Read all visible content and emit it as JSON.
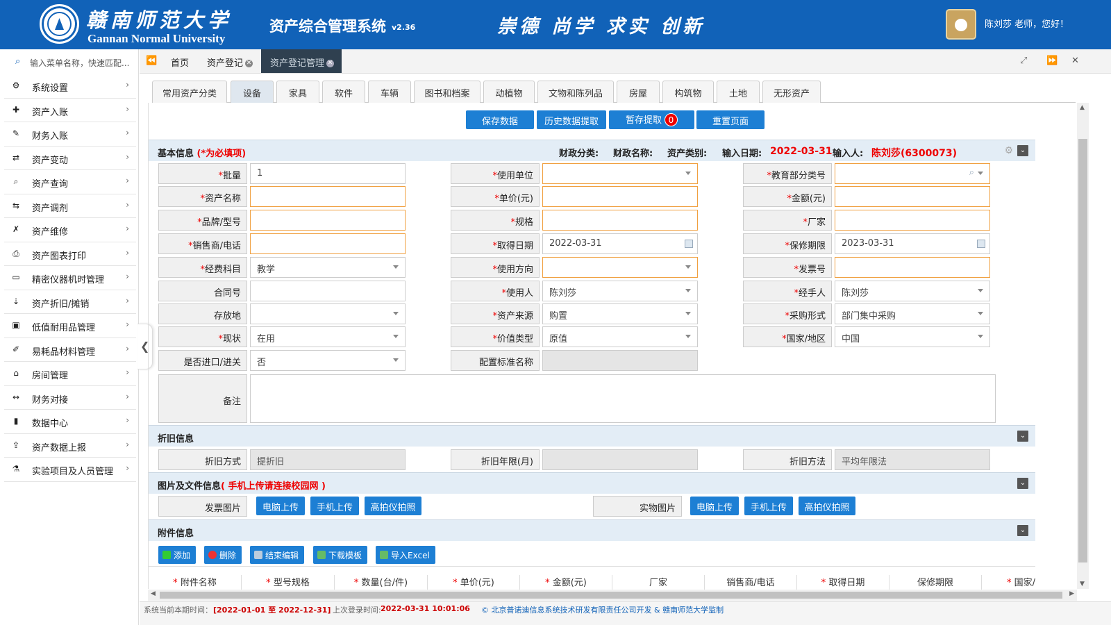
{
  "header": {
    "univ_cn": "赣南师范大学",
    "univ_en": "Gannan Normal University",
    "system_title": "资产综合管理系统",
    "version": "v2.36",
    "motto": "崇德 尚学 求实 创新",
    "greeting": "陈刘莎 老师，您好！"
  },
  "sidebar": {
    "search_placeholder": "输入菜单名称，快速匹配...",
    "items": [
      {
        "label": "系统设置",
        "icon": "gear-icon",
        "glyph": "⚙"
      },
      {
        "label": "资产入账",
        "icon": "plus-icon",
        "glyph": "✚"
      },
      {
        "label": "财务入账",
        "icon": "edit-icon",
        "glyph": "✎"
      },
      {
        "label": "资产变动",
        "icon": "shuffle-icon",
        "glyph": "⇄"
      },
      {
        "label": "资产查询",
        "icon": "search-icon",
        "glyph": "⌕"
      },
      {
        "label": "资产调剂",
        "icon": "exchange-icon",
        "glyph": "⇆"
      },
      {
        "label": "资产维修",
        "icon": "wrench-icon",
        "glyph": "✗"
      },
      {
        "label": "资产图表打印",
        "icon": "print-icon",
        "glyph": "⎙"
      },
      {
        "label": "精密仪器机时管理",
        "icon": "monitor-icon",
        "glyph": "▭"
      },
      {
        "label": "资产折旧/摊销",
        "icon": "sort-icon",
        "glyph": "⇣"
      },
      {
        "label": "低值耐用品管理",
        "icon": "money-icon",
        "glyph": "▣"
      },
      {
        "label": "易耗品材料管理",
        "icon": "tools-icon",
        "glyph": "✐"
      },
      {
        "label": "房间管理",
        "icon": "home-icon",
        "glyph": "⌂"
      },
      {
        "label": "财务对接",
        "icon": "link-icon",
        "glyph": "↔"
      },
      {
        "label": "数据中心",
        "icon": "book-icon",
        "glyph": "▮"
      },
      {
        "label": "资产数据上报",
        "icon": "upload-icon",
        "glyph": "⇪"
      },
      {
        "label": "实验项目及人员管理",
        "icon": "flask-icon",
        "glyph": "⚗"
      }
    ]
  },
  "page_tabs": [
    "首页",
    "资产登记",
    "资产登记管理"
  ],
  "asset_tabs": [
    "常用资产分类",
    "设备",
    "家具",
    "软件",
    "车辆",
    "图书和档案",
    "动植物",
    "文物和陈列品",
    "房屋",
    "构筑物",
    "土地",
    "无形资产"
  ],
  "actions": {
    "save": "保存数据",
    "history": "历史数据提取",
    "temp": "暂存提取",
    "temp_count": "0",
    "reset": "重置页面"
  },
  "basic": {
    "title": "基本信息",
    "required_note": "(*为必填项)",
    "fin_category_label": "财政分类:",
    "fin_name_label": "财政名称:",
    "asset_type_label": "资产类别:",
    "entry_date_label": "输入日期:",
    "entry_date": "2022-03-31",
    "entry_user_label": "输入人:",
    "entry_user": "陈刘莎(6300073)",
    "fields": {
      "batch": {
        "label": "批量",
        "value": "1"
      },
      "use_unit": {
        "label": "使用单位",
        "value": ""
      },
      "edu_code": {
        "label": "教育部分类号",
        "value": ""
      },
      "asset_name": {
        "label": "资产名称",
        "value": ""
      },
      "unit_price": {
        "label": "单价(元)",
        "value": ""
      },
      "amount": {
        "label": "金额(元)",
        "value": ""
      },
      "brand": {
        "label": "品牌/型号",
        "value": ""
      },
      "spec": {
        "label": "规格",
        "value": ""
      },
      "maker": {
        "label": "厂家",
        "value": ""
      },
      "seller": {
        "label": "销售商/电话",
        "value": ""
      },
      "acquire_date": {
        "label": "取得日期",
        "value": "2022-03-31"
      },
      "warranty": {
        "label": "保修期限",
        "value": "2023-03-31"
      },
      "fund": {
        "label": "经费科目",
        "value": "教学"
      },
      "use_dir": {
        "label": "使用方向",
        "value": ""
      },
      "invoice": {
        "label": "发票号",
        "value": ""
      },
      "contract": {
        "label": "合同号",
        "value": ""
      },
      "user": {
        "label": "使用人",
        "value": "陈刘莎"
      },
      "handler": {
        "label": "经手人",
        "value": "陈刘莎"
      },
      "location": {
        "label": "存放地",
        "value": ""
      },
      "source": {
        "label": "资产来源",
        "value": "购置"
      },
      "purchase": {
        "label": "采购形式",
        "value": "部门集中采购"
      },
      "status": {
        "label": "现状",
        "value": "在用"
      },
      "value_type": {
        "label": "价值类型",
        "value": "原值"
      },
      "country": {
        "label": "国家/地区",
        "value": "中国"
      },
      "imported": {
        "label": "是否进口/进关",
        "value": "否"
      },
      "std_name": {
        "label": "配置标准名称",
        "value": ""
      },
      "remark": {
        "label": "备注",
        "value": ""
      }
    }
  },
  "depreciation": {
    "title": "折旧信息",
    "method_label": "折旧方式",
    "method": "提折旧",
    "years_label": "折旧年限(月)",
    "years": "",
    "algo_label": "折旧方法",
    "algo": "平均年限法"
  },
  "files": {
    "title": "图片及文件信息",
    "note": "( 手机上传请连接校园网 )",
    "invoice_pic": "发票图片",
    "real_pic": "实物图片",
    "pc_upload": "电脑上传",
    "mobile_upload": "手机上传",
    "camera": "高拍仪拍照"
  },
  "attach": {
    "title": "附件信息",
    "add": "添加",
    "delete": "删除",
    "end_edit": "结束编辑",
    "download": "下载模板",
    "import": "导入Excel",
    "columns": [
      {
        "label": "附件名称",
        "req": true
      },
      {
        "label": "型号规格",
        "req": true
      },
      {
        "label": "数量(台/件)",
        "req": true
      },
      {
        "label": "单价(元)",
        "req": true
      },
      {
        "label": "金额(元)",
        "req": true
      },
      {
        "label": "厂家",
        "req": false
      },
      {
        "label": "销售商/电话",
        "req": false
      },
      {
        "label": "取得日期",
        "req": true
      },
      {
        "label": "保修期限",
        "req": false
      },
      {
        "label": "国家/",
        "req": true
      }
    ]
  },
  "statusbar": {
    "period_label": "系统当前本期时间：",
    "period": "[2022-01-01 至 2022-12-31]",
    "last_login_label": "上次登录时间:",
    "last_login": "2022-03-31 10:01:06",
    "copyright": "© 北京普诺迪信息系统技术研发有限责任公司开发 & 赣南师范大学监制"
  },
  "colors": {
    "brand": "#1162b8",
    "button": "#1d7fd4",
    "required": "#e00000",
    "required_border": "#f0a040"
  }
}
